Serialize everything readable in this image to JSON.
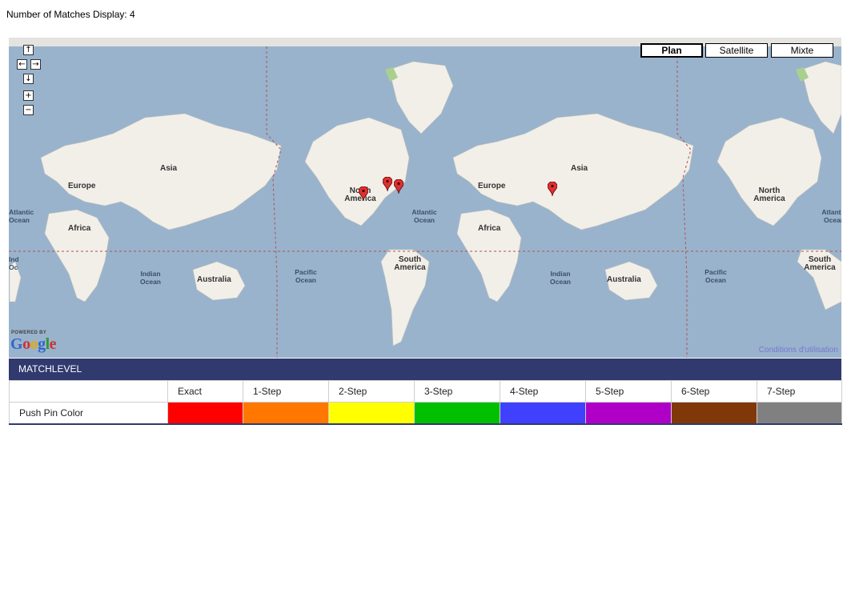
{
  "matches": {
    "label": "Number of Matches Display: 4"
  },
  "map": {
    "nav": {
      "up": "↑",
      "left": "←",
      "right": "→",
      "down": "↓",
      "zoom_in": "+",
      "zoom_out": "−"
    },
    "map_types": [
      "Plan",
      "Satellite",
      "Mixte"
    ],
    "active_map_type": "Plan",
    "labels": {
      "asia_1": "Asia",
      "europe_1": "Europe",
      "africa_1": "Africa",
      "australia_1": "Australia",
      "north_america_1": "North America",
      "south_america_1": "South America",
      "asia_2": "Asia",
      "europe_2": "Europe",
      "africa_2": "Africa",
      "australia_2": "Australia",
      "north_america_2": "North America",
      "south_america_2": "South America",
      "atlantic_left": "Atlantic Ocean",
      "indian_1": "Indian Ocean",
      "pacific_1": "Pacific Ocean",
      "atlantic_1": "Atlantic Ocean",
      "indian_2": "Indian Ocean",
      "pacific_2": "Pacific Ocean",
      "atlantic_right": "Atlantic Ocean",
      "indian_left_fragment": "Indian Ocean"
    },
    "pins_count": 4,
    "pin_color": "#e03030",
    "powered_by": "POWERED BY",
    "google_logo": "Google",
    "terms_link": "Conditions d'utilisation"
  },
  "legend": {
    "header": "MATCHLEVEL",
    "row_label": "Push Pin Color",
    "levels": [
      {
        "name": "Exact",
        "color": "#ff0000"
      },
      {
        "name": "1-Step",
        "color": "#ff7700"
      },
      {
        "name": "2-Step",
        "color": "#ffff00"
      },
      {
        "name": "3-Step",
        "color": "#00c000"
      },
      {
        "name": "4-Step",
        "color": "#4040ff"
      },
      {
        "name": "5-Step",
        "color": "#b000c8"
      },
      {
        "name": "6-Step",
        "color": "#803808"
      },
      {
        "name": "7-Step",
        "color": "#808080"
      }
    ]
  }
}
